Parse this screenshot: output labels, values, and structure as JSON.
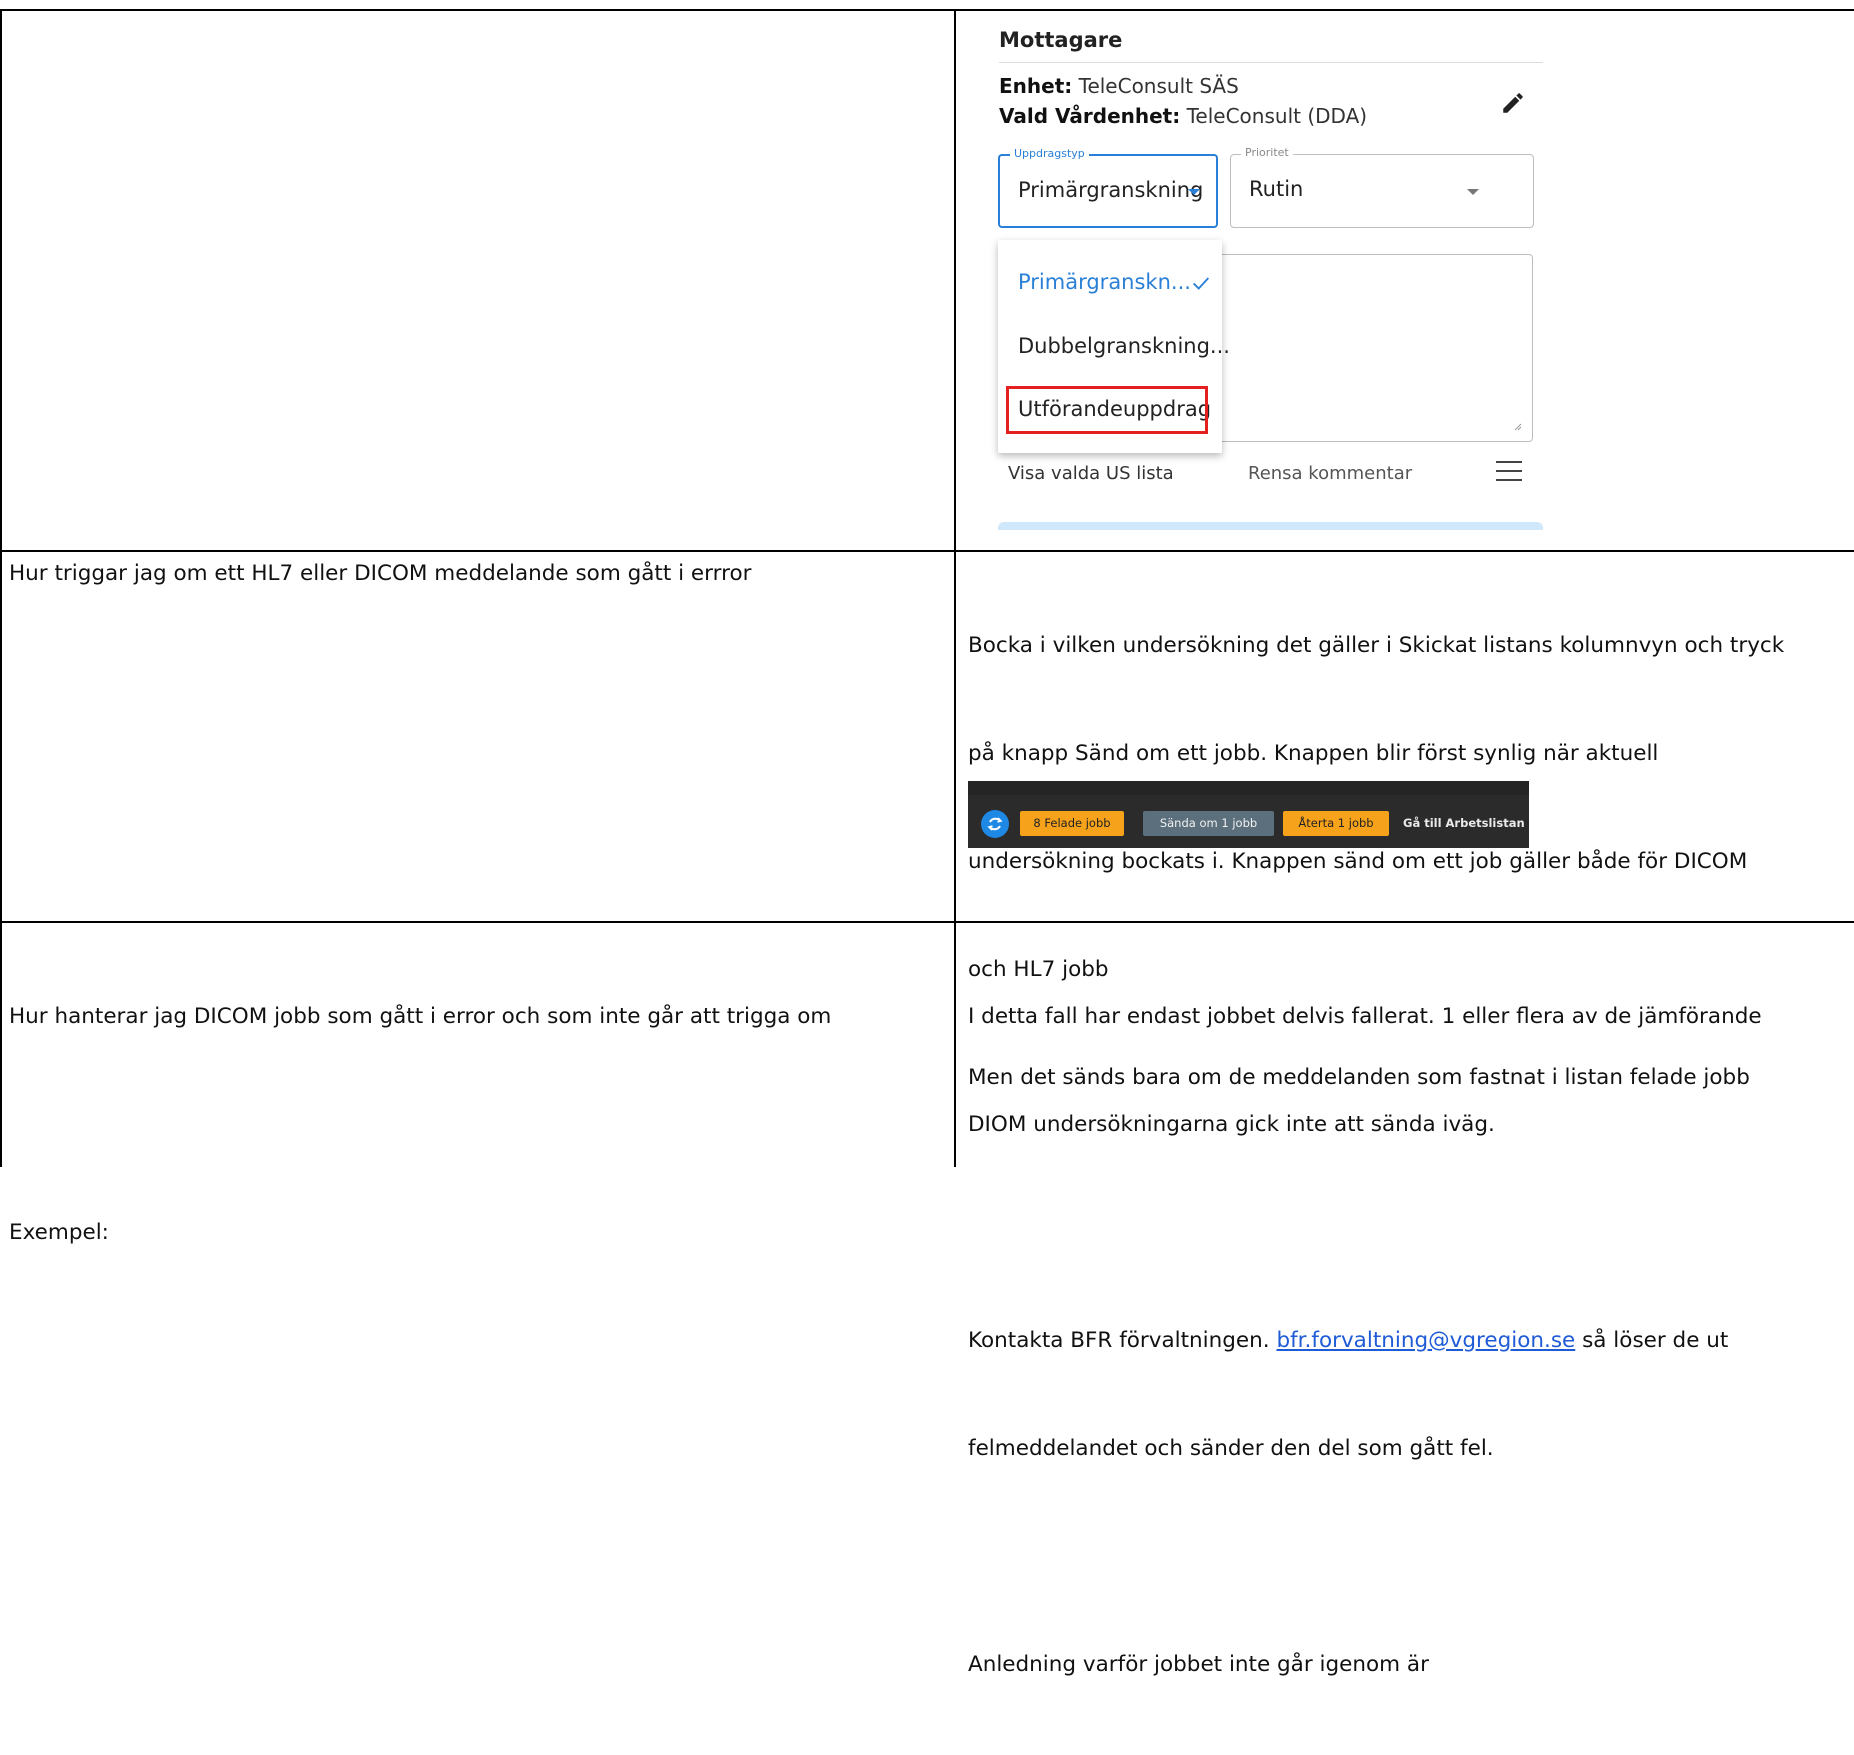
{
  "form": {
    "title": "Mottagare",
    "enhet_label": "Enhet:",
    "enhet_value": " TeleConsult SÄS",
    "vald_label": "Vald Vårdenhet:",
    "vald_value": " TeleConsult (DDA)",
    "uppdragstyp_label": "Uppdragstyp",
    "uppdragstyp_value": "Primärgranskning",
    "prioritet_label": "Prioritet",
    "prioritet_value": "Rutin",
    "menu_items": [
      "Primärgranskn...",
      "Dubbelgranskning...",
      "Utförandeuppdrag"
    ],
    "visa_label": "Visa valda US lista",
    "rensa_label": "Rensa kommentar",
    "accent_color": "#2a7fd6",
    "highlight_color": "#e41f1f",
    "icons": [
      "pencil-icon",
      "caret-down-icon",
      "check-icon",
      "menu-icon"
    ]
  },
  "rows": [
    {
      "question": "Hur triggar jag om ett HL7 eller DICOM meddelande som gått i errror",
      "answer_lines": [
        "Bocka i vilken undersökning det gäller i Skickat listans kolumnvyn och tryck",
        "på knapp Sänd om ett jobb. Knappen blir först synlig när aktuell",
        "undersökning bockats i. Knappen sänd om ett job gäller både för DICOM",
        "och HL7 jobb",
        "Men det sänds bara om de meddelanden som fastnat i listan felade jobb"
      ]
    },
    {
      "question": "Hur hanterar jag DICOM jobb som gått i error och som inte går att trigga om",
      "question_extra": "Exempel:",
      "answer_line1": "I detta fall har endast jobbet delvis fallerat. 1 eller flera av de jämförande",
      "answer_line2": "DIOM undersökningarna gick inte att sända iväg.",
      "contact_prefix": "Kontakta BFR förvaltningen. ",
      "contact_email": "bfr.forvaltning@vgregion.se",
      "contact_suffix": " så löser de ut",
      "contact_line2": "felmeddelandet och sänder den del som gått fel.",
      "reason_line": "Anledning varför jobbet inte går igenom är"
    }
  ],
  "toolbar": {
    "felade": "8 Felade jobb",
    "sanda": "Sända om 1 jobb",
    "aterta": "Återta 1 jobb",
    "ga_till": "Gå till Arbetslistan",
    "orange": "#f7a21b",
    "slate": "#5b6f7c"
  }
}
